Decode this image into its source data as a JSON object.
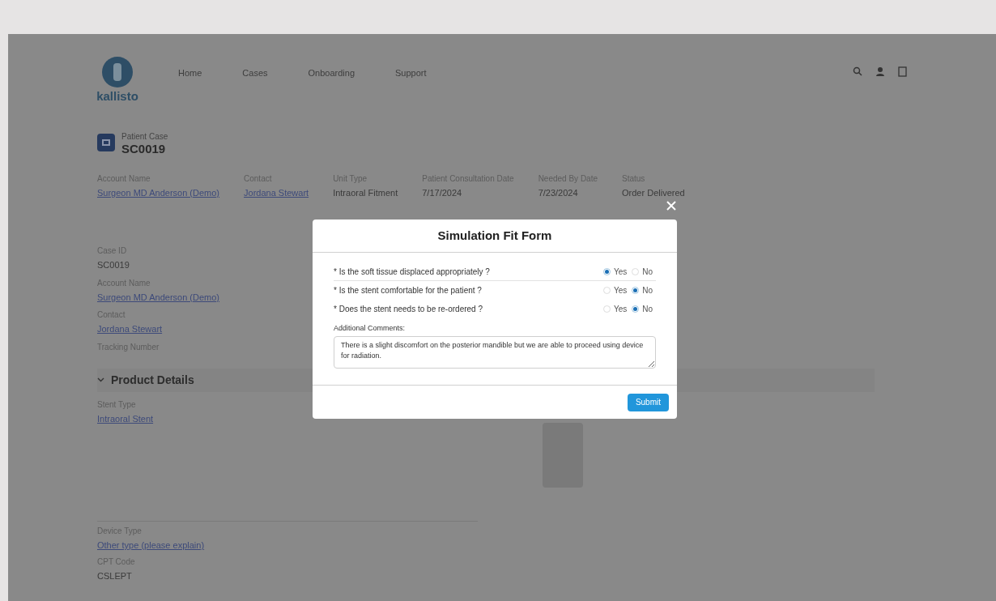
{
  "app": {
    "logo_text": "kallisto",
    "nav": [
      {
        "label": "Home"
      },
      {
        "label": "Cases"
      },
      {
        "label": "Onboarding"
      },
      {
        "label": "Support"
      }
    ]
  },
  "record": {
    "type_label": "Patient Case",
    "id": "SC0019"
  },
  "header_fields": [
    {
      "label": "Account Name",
      "value": "Surgeon MD Anderson (Demo)",
      "link": true
    },
    {
      "label": "Contact",
      "value": "Jordana Stewart",
      "link": true
    },
    {
      "label": "Unit Type",
      "value": "Intraoral Fitment",
      "link": false
    },
    {
      "label": "Patient Consultation Date",
      "value": "7/17/2024",
      "link": false
    },
    {
      "label": "Needed By Date",
      "value": "7/23/2024",
      "link": false
    },
    {
      "label": "Status",
      "value": "Order Delivered",
      "link": false
    }
  ],
  "details": [
    {
      "label": "Case ID",
      "value": "SC0019",
      "link": false
    },
    {
      "label": "Account Name",
      "value": "Surgeon MD Anderson (Demo)",
      "link": true
    },
    {
      "label": "Contact",
      "value": "Jordana Stewart",
      "link": true
    },
    {
      "label": "Tracking Number",
      "link": false
    }
  ],
  "product_details": {
    "title": "Product Details",
    "expanded": true,
    "fields": [
      {
        "label": "Stent Type",
        "value": "Intraoral Stent",
        "link": true
      },
      {
        "label": "Device Type",
        "value": "Other type (please explain)",
        "link": true
      },
      {
        "label": "CPT Code",
        "value": "CSLEPT",
        "link": false
      }
    ]
  },
  "modal": {
    "title": "Simulation Fit Form",
    "questions": [
      {
        "text": "* Is the soft tissue displaced appropriately ?",
        "options": [
          {
            "label": "Yes",
            "selected": true
          },
          {
            "label": "No",
            "selected": false
          }
        ]
      },
      {
        "text": "* Is the stent comfortable for the patient ?",
        "options": [
          {
            "label": "Yes",
            "selected": false
          },
          {
            "label": "No",
            "selected": true
          }
        ]
      },
      {
        "text": "* Does the stent needs to be re-ordered ?",
        "options": [
          {
            "label": "Yes",
            "selected": false
          },
          {
            "label": "No",
            "selected": true
          }
        ]
      }
    ],
    "comments_label": "Additional Comments:",
    "comments": "There is a slight discomfort on the posterior mandible but we are able to proceed using device for radiation.",
    "submit": "Submit"
  }
}
